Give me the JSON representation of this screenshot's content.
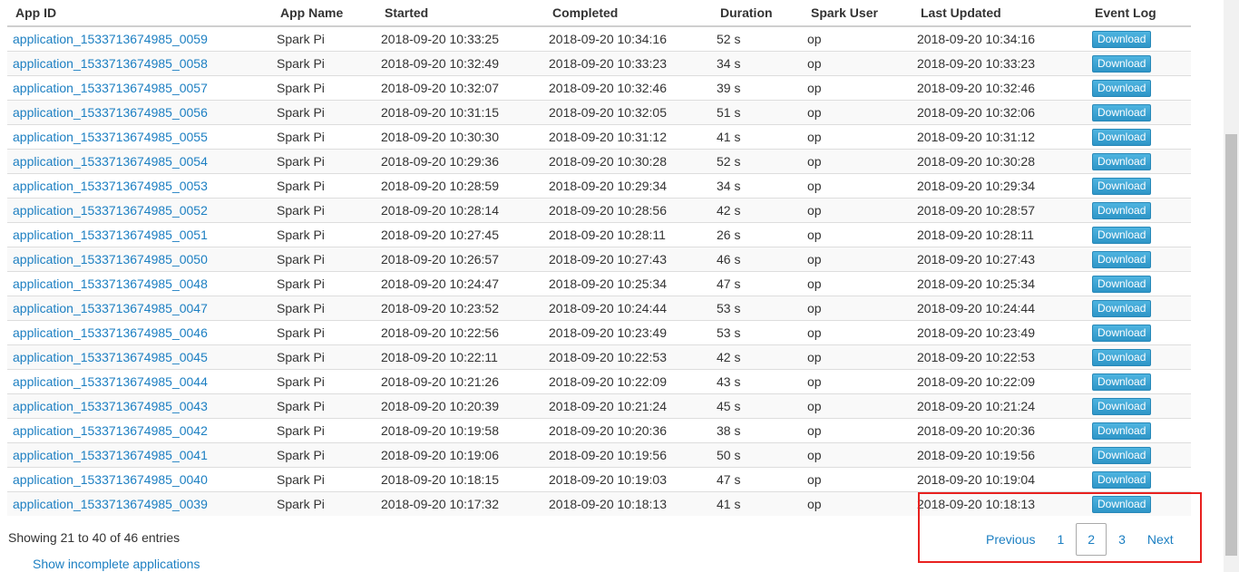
{
  "table": {
    "headers": {
      "app_id": "App ID",
      "app_name": "App Name",
      "started": "Started",
      "completed": "Completed",
      "duration": "Duration",
      "spark_user": "Spark User",
      "last_updated": "Last Updated",
      "event_log": "Event Log"
    },
    "rows": [
      {
        "app_id": "application_1533713674985_0059",
        "app_name": "Spark Pi",
        "started": "2018-09-20 10:33:25",
        "completed": "2018-09-20 10:34:16",
        "duration": "52 s",
        "user": "op",
        "last_updated": "2018-09-20 10:34:16",
        "event_log": "Download"
      },
      {
        "app_id": "application_1533713674985_0058",
        "app_name": "Spark Pi",
        "started": "2018-09-20 10:32:49",
        "completed": "2018-09-20 10:33:23",
        "duration": "34 s",
        "user": "op",
        "last_updated": "2018-09-20 10:33:23",
        "event_log": "Download"
      },
      {
        "app_id": "application_1533713674985_0057",
        "app_name": "Spark Pi",
        "started": "2018-09-20 10:32:07",
        "completed": "2018-09-20 10:32:46",
        "duration": "39 s",
        "user": "op",
        "last_updated": "2018-09-20 10:32:46",
        "event_log": "Download"
      },
      {
        "app_id": "application_1533713674985_0056",
        "app_name": "Spark Pi",
        "started": "2018-09-20 10:31:15",
        "completed": "2018-09-20 10:32:05",
        "duration": "51 s",
        "user": "op",
        "last_updated": "2018-09-20 10:32:06",
        "event_log": "Download"
      },
      {
        "app_id": "application_1533713674985_0055",
        "app_name": "Spark Pi",
        "started": "2018-09-20 10:30:30",
        "completed": "2018-09-20 10:31:12",
        "duration": "41 s",
        "user": "op",
        "last_updated": "2018-09-20 10:31:12",
        "event_log": "Download"
      },
      {
        "app_id": "application_1533713674985_0054",
        "app_name": "Spark Pi",
        "started": "2018-09-20 10:29:36",
        "completed": "2018-09-20 10:30:28",
        "duration": "52 s",
        "user": "op",
        "last_updated": "2018-09-20 10:30:28",
        "event_log": "Download"
      },
      {
        "app_id": "application_1533713674985_0053",
        "app_name": "Spark Pi",
        "started": "2018-09-20 10:28:59",
        "completed": "2018-09-20 10:29:34",
        "duration": "34 s",
        "user": "op",
        "last_updated": "2018-09-20 10:29:34",
        "event_log": "Download"
      },
      {
        "app_id": "application_1533713674985_0052",
        "app_name": "Spark Pi",
        "started": "2018-09-20 10:28:14",
        "completed": "2018-09-20 10:28:56",
        "duration": "42 s",
        "user": "op",
        "last_updated": "2018-09-20 10:28:57",
        "event_log": "Download"
      },
      {
        "app_id": "application_1533713674985_0051",
        "app_name": "Spark Pi",
        "started": "2018-09-20 10:27:45",
        "completed": "2018-09-20 10:28:11",
        "duration": "26 s",
        "user": "op",
        "last_updated": "2018-09-20 10:28:11",
        "event_log": "Download"
      },
      {
        "app_id": "application_1533713674985_0050",
        "app_name": "Spark Pi",
        "started": "2018-09-20 10:26:57",
        "completed": "2018-09-20 10:27:43",
        "duration": "46 s",
        "user": "op",
        "last_updated": "2018-09-20 10:27:43",
        "event_log": "Download"
      },
      {
        "app_id": "application_1533713674985_0048",
        "app_name": "Spark Pi",
        "started": "2018-09-20 10:24:47",
        "completed": "2018-09-20 10:25:34",
        "duration": "47 s",
        "user": "op",
        "last_updated": "2018-09-20 10:25:34",
        "event_log": "Download"
      },
      {
        "app_id": "application_1533713674985_0047",
        "app_name": "Spark Pi",
        "started": "2018-09-20 10:23:52",
        "completed": "2018-09-20 10:24:44",
        "duration": "53 s",
        "user": "op",
        "last_updated": "2018-09-20 10:24:44",
        "event_log": "Download"
      },
      {
        "app_id": "application_1533713674985_0046",
        "app_name": "Spark Pi",
        "started": "2018-09-20 10:22:56",
        "completed": "2018-09-20 10:23:49",
        "duration": "53 s",
        "user": "op",
        "last_updated": "2018-09-20 10:23:49",
        "event_log": "Download"
      },
      {
        "app_id": "application_1533713674985_0045",
        "app_name": "Spark Pi",
        "started": "2018-09-20 10:22:11",
        "completed": "2018-09-20 10:22:53",
        "duration": "42 s",
        "user": "op",
        "last_updated": "2018-09-20 10:22:53",
        "event_log": "Download"
      },
      {
        "app_id": "application_1533713674985_0044",
        "app_name": "Spark Pi",
        "started": "2018-09-20 10:21:26",
        "completed": "2018-09-20 10:22:09",
        "duration": "43 s",
        "user": "op",
        "last_updated": "2018-09-20 10:22:09",
        "event_log": "Download"
      },
      {
        "app_id": "application_1533713674985_0043",
        "app_name": "Spark Pi",
        "started": "2018-09-20 10:20:39",
        "completed": "2018-09-20 10:21:24",
        "duration": "45 s",
        "user": "op",
        "last_updated": "2018-09-20 10:21:24",
        "event_log": "Download"
      },
      {
        "app_id": "application_1533713674985_0042",
        "app_name": "Spark Pi",
        "started": "2018-09-20 10:19:58",
        "completed": "2018-09-20 10:20:36",
        "duration": "38 s",
        "user": "op",
        "last_updated": "2018-09-20 10:20:36",
        "event_log": "Download"
      },
      {
        "app_id": "application_1533713674985_0041",
        "app_name": "Spark Pi",
        "started": "2018-09-20 10:19:06",
        "completed": "2018-09-20 10:19:56",
        "duration": "50 s",
        "user": "op",
        "last_updated": "2018-09-20 10:19:56",
        "event_log": "Download"
      },
      {
        "app_id": "application_1533713674985_0040",
        "app_name": "Spark Pi",
        "started": "2018-09-20 10:18:15",
        "completed": "2018-09-20 10:19:03",
        "duration": "47 s",
        "user": "op",
        "last_updated": "2018-09-20 10:19:04",
        "event_log": "Download"
      },
      {
        "app_id": "application_1533713674985_0039",
        "app_name": "Spark Pi",
        "started": "2018-09-20 10:17:32",
        "completed": "2018-09-20 10:18:13",
        "duration": "41 s",
        "user": "op",
        "last_updated": "2018-09-20 10:18:13",
        "event_log": "Download"
      }
    ]
  },
  "footer": {
    "showing_text": "Showing 21 to 40 of 46 entries",
    "incomplete_link": "Show incomplete applications"
  },
  "pagination": {
    "previous": "Previous",
    "pages": [
      "1",
      "2",
      "3"
    ],
    "current_page": "2",
    "next": "Next"
  },
  "colors": {
    "link": "#1c7fc2",
    "download_button": "#3aa3d4",
    "highlight_box": "#e8211f"
  }
}
